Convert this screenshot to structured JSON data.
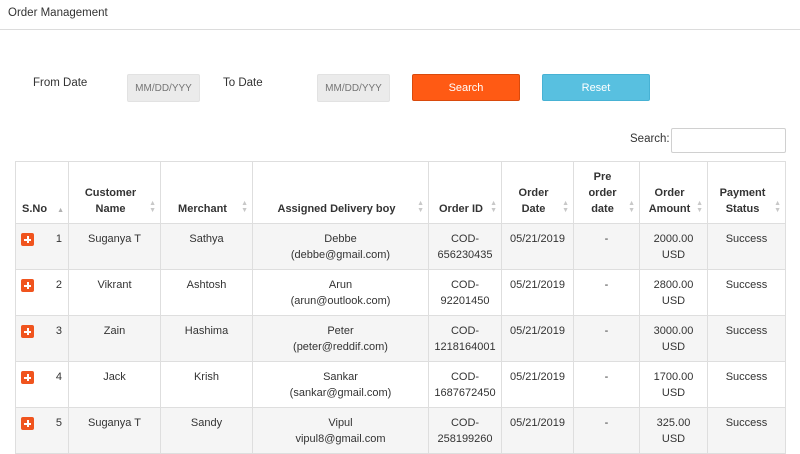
{
  "header": {
    "title": "Order Management"
  },
  "filters": {
    "from_label": "From Date",
    "from_placeholder": "MM/DD/YYY",
    "to_label": "To Date",
    "to_placeholder": "MM/DD/YYY",
    "search_button": "Search",
    "reset_button": "Reset"
  },
  "table_search": {
    "label": "Search:"
  },
  "table": {
    "columns": [
      {
        "line1": "S.No",
        "line2": "",
        "line3": ""
      },
      {
        "line1": "Customer",
        "line2": "Name",
        "line3": ""
      },
      {
        "line1": "Merchant",
        "line2": "",
        "line3": ""
      },
      {
        "line1": "Assigned Delivery boy",
        "line2": "",
        "line3": ""
      },
      {
        "line1": "Order ID",
        "line2": "",
        "line3": ""
      },
      {
        "line1": "Order",
        "line2": "Date",
        "line3": ""
      },
      {
        "line1": "Pre",
        "line2": "order",
        "line3": "date"
      },
      {
        "line1": "Order",
        "line2": "Amount",
        "line3": ""
      },
      {
        "line1": "Payment",
        "line2": "Status",
        "line3": ""
      }
    ],
    "rows": [
      {
        "sno": "1",
        "customer": "Suganya T",
        "merchant": "Sathya",
        "delivery_name": "Debbe",
        "delivery_email": "(debbe@gmail.com)",
        "order_id_1": "COD-",
        "order_id_2": "656230435",
        "order_date": "05/21/2019",
        "pre_order": "-",
        "amount_1": "2000.00",
        "amount_2": "USD",
        "status": "Success"
      },
      {
        "sno": "2",
        "customer": "Vikrant",
        "merchant": "Ashtosh",
        "delivery_name": "Arun",
        "delivery_email": "(arun@outlook.com)",
        "order_id_1": "COD-",
        "order_id_2": "92201450",
        "order_date": "05/21/2019",
        "pre_order": "-",
        "amount_1": "2800.00",
        "amount_2": "USD",
        "status": "Success"
      },
      {
        "sno": "3",
        "customer": "Zain",
        "merchant": "Hashima",
        "delivery_name": "Peter",
        "delivery_email": "(peter@reddif.com)",
        "order_id_1": "COD-",
        "order_id_2": "1218164001",
        "order_date": "05/21/2019",
        "pre_order": "-",
        "amount_1": "3000.00",
        "amount_2": "USD",
        "status": "Success"
      },
      {
        "sno": "4",
        "customer": "Jack",
        "merchant": "Krish",
        "delivery_name": "Sankar",
        "delivery_email": "(sankar@gmail.com)",
        "order_id_1": "COD-",
        "order_id_2": "1687672450",
        "order_date": "05/21/2019",
        "pre_order": "-",
        "amount_1": "1700.00",
        "amount_2": "USD",
        "status": "Success"
      },
      {
        "sno": "5",
        "customer": "Suganya T",
        "merchant": "Sandy",
        "delivery_name": "Vipul",
        "delivery_email": "vipul8@gmail.com",
        "order_id_1": "COD-",
        "order_id_2": "258199260",
        "order_date": "05/21/2019",
        "pre_order": "-",
        "amount_1": "325.00 USD",
        "amount_2": "",
        "status": "Success"
      }
    ]
  },
  "icons": {
    "expand": "plus-square-icon",
    "sort": "sort-arrows-icon"
  },
  "colors": {
    "search_button": "#ff5a14",
    "reset_button": "#58c0e0",
    "expand_icon": "#f0541e"
  }
}
